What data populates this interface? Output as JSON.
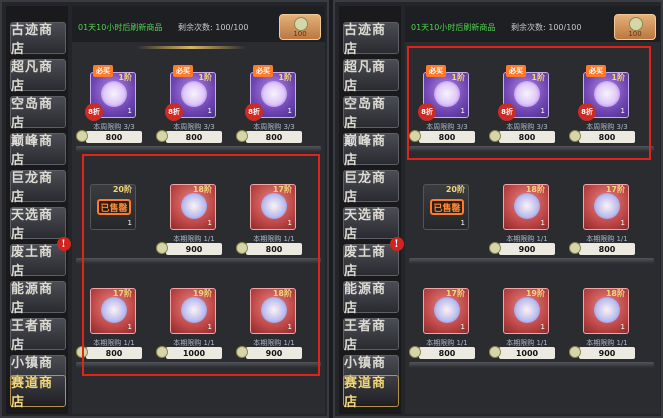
{
  "sidebar": [
    "古迹商店",
    "超凡商店",
    "空岛商店",
    "巅峰商店",
    "巨龙商店",
    "天选商店",
    "废土商店",
    "能源商店",
    "王者商店",
    "小镇商店",
    "赛道商店"
  ],
  "badge": "!",
  "topbar": {
    "timer": "01天10小时后刷新商品",
    "remain": "剩余次数: 100/100",
    "coin_count": "100"
  },
  "items": [
    {
      "type": "purple",
      "tag": "必买",
      "level": "1阶",
      "qty": "1",
      "discount": "8折",
      "limit": "本周限购 3/3",
      "price": "800"
    },
    {
      "type": "purple",
      "tag": "必买",
      "level": "1阶",
      "qty": "1",
      "discount": "8折",
      "limit": "本周限购 3/3",
      "price": "800"
    },
    {
      "type": "purple",
      "tag": "必买",
      "level": "1阶",
      "qty": "1",
      "discount": "8折",
      "limit": "本周限购 3/3",
      "price": "800"
    },
    {
      "type": "dark",
      "level": "20阶",
      "qty": "1",
      "soldout": "已售罄",
      "limit": "",
      "price": ""
    },
    {
      "type": "red",
      "level": "18阶",
      "qty": "1",
      "limit": "本期限购 1/1",
      "price": "900"
    },
    {
      "type": "red",
      "level": "17阶",
      "qty": "1",
      "limit": "本期限购 1/1",
      "price": "800"
    },
    {
      "type": "red",
      "level": "17阶",
      "qty": "1",
      "limit": "本期限购 1/1",
      "price": "800"
    },
    {
      "type": "red",
      "level": "19阶",
      "qty": "1",
      "limit": "本期限购 1/1",
      "price": "1000"
    },
    {
      "type": "red",
      "level": "18阶",
      "qty": "1",
      "limit": "本期限购 1/1",
      "price": "900"
    }
  ]
}
